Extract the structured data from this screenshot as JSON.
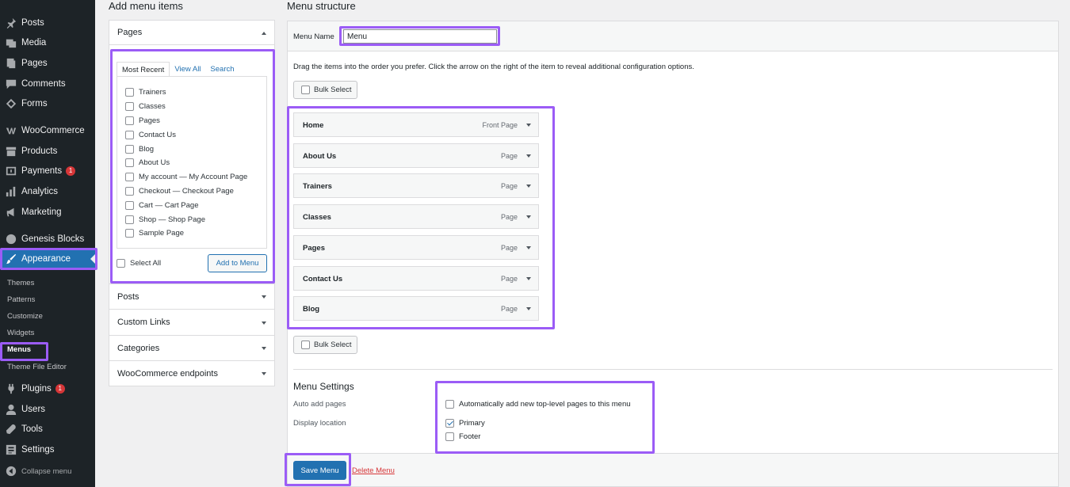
{
  "sidebar": {
    "items": [
      {
        "label": "Posts",
        "icon": "pin-icon"
      },
      {
        "label": "Media",
        "icon": "media-icon"
      },
      {
        "label": "Pages",
        "icon": "page-icon"
      },
      {
        "label": "Comments",
        "icon": "comment-icon"
      },
      {
        "label": "Forms",
        "icon": "forms-icon"
      },
      {
        "label": "WooCommerce",
        "icon": "woocommerce-icon"
      },
      {
        "label": "Products",
        "icon": "archive-icon"
      },
      {
        "label": "Payments",
        "icon": "payments-icon",
        "badge": "1"
      },
      {
        "label": "Analytics",
        "icon": "chart-icon"
      },
      {
        "label": "Marketing",
        "icon": "megaphone-icon"
      },
      {
        "label": "Genesis Blocks",
        "icon": "genesis-icon"
      },
      {
        "label": "Appearance",
        "icon": "brush-icon"
      },
      {
        "label": "Plugins",
        "icon": "plugin-icon",
        "badge": "1"
      },
      {
        "label": "Users",
        "icon": "users-icon"
      },
      {
        "label": "Tools",
        "icon": "wrench-icon"
      },
      {
        "label": "Settings",
        "icon": "settings-icon"
      }
    ],
    "submenu": [
      "Themes",
      "Patterns",
      "Customize",
      "Widgets",
      "Menus",
      "Theme File Editor"
    ],
    "collapse_label": "Collapse menu"
  },
  "add_items": {
    "heading": "Add menu items",
    "pages_title": "Pages",
    "tabs": [
      "Most Recent",
      "View All",
      "Search"
    ],
    "pages": [
      "Trainers",
      "Classes",
      "Pages",
      "Contact Us",
      "Blog",
      "About Us",
      "My account — My Account Page",
      "Checkout — Checkout Page",
      "Cart — Cart Page",
      "Shop — Shop Page",
      "Sample Page"
    ],
    "select_all": "Select All",
    "add_button": "Add to Menu",
    "sections": [
      "Posts",
      "Custom Links",
      "Categories",
      "WooCommerce endpoints"
    ]
  },
  "structure": {
    "heading": "Menu structure",
    "name_label": "Menu Name",
    "name_value": "Menu",
    "instructions": "Drag the items into the order you prefer. Click the arrow on the right of the item to reveal additional configuration options.",
    "bulk_select": "Bulk Select",
    "items": [
      {
        "title": "Home",
        "type": "Front Page"
      },
      {
        "title": "About Us",
        "type": "Page"
      },
      {
        "title": "Trainers",
        "type": "Page"
      },
      {
        "title": "Classes",
        "type": "Page"
      },
      {
        "title": "Pages",
        "type": "Page"
      },
      {
        "title": "Contact Us",
        "type": "Page"
      },
      {
        "title": "Blog",
        "type": "Page"
      }
    ],
    "settings_heading": "Menu Settings",
    "auto_add_label": "Auto add pages",
    "auto_add_option": "Automatically add new top-level pages to this menu",
    "display_location_label": "Display location",
    "locations": [
      {
        "label": "Primary",
        "checked": true
      },
      {
        "label": "Footer",
        "checked": false
      }
    ],
    "save_button": "Save Menu",
    "delete_link": "Delete Menu"
  },
  "colors": {
    "admin_bar": "#1d2327",
    "accent": "#2271b1",
    "highlight": "#9b5cf6",
    "badge": "#d63638"
  }
}
